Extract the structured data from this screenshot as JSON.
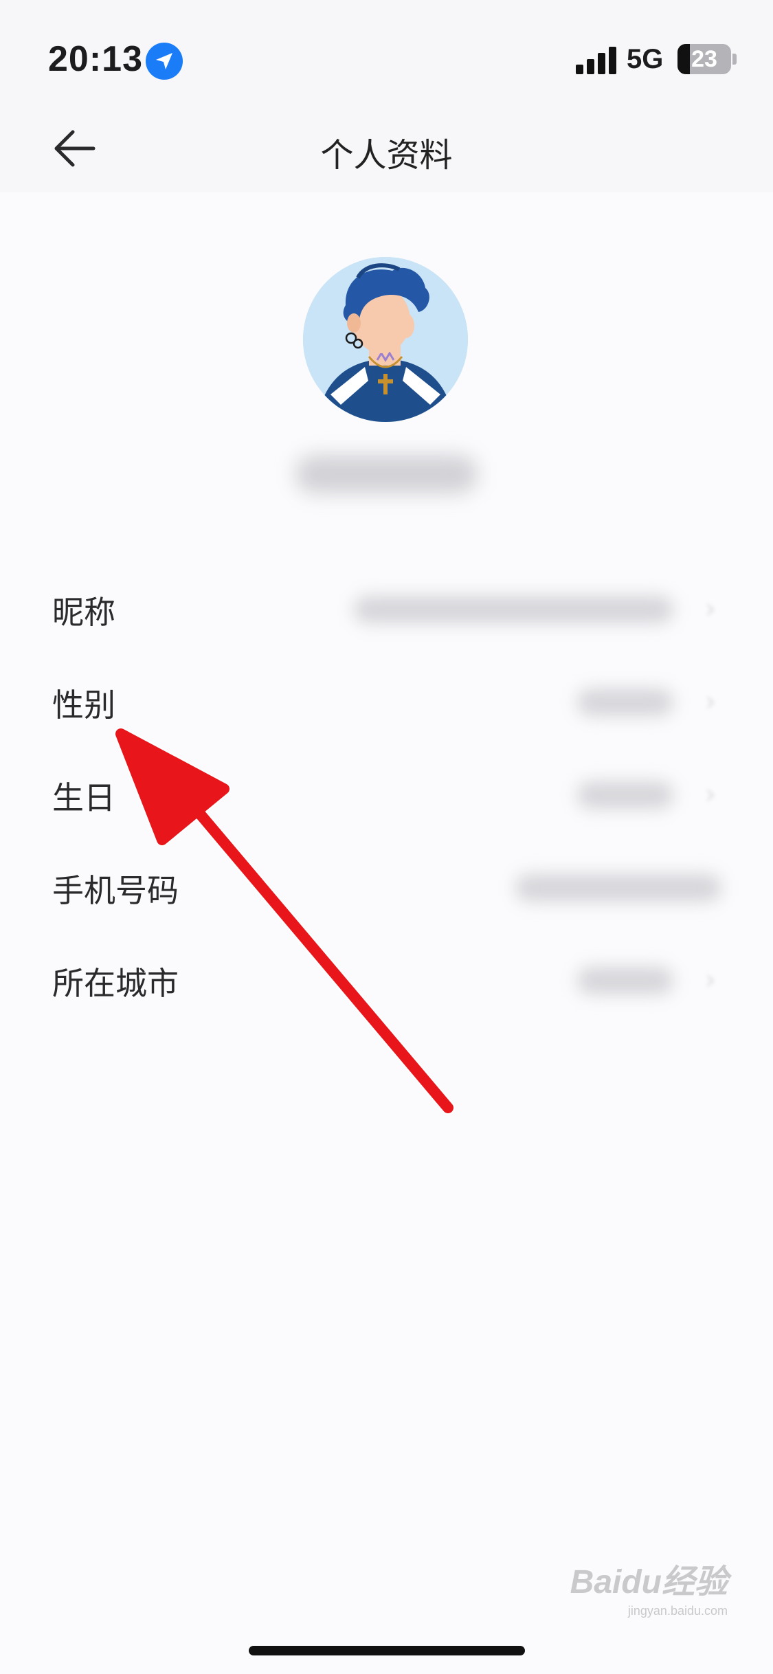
{
  "status_bar": {
    "time": "20:13",
    "network": "5G",
    "battery_level": "23",
    "battery_fraction": 0.23,
    "location_icon": "location-arrow-icon",
    "signal_icon": "cellular-signal-icon"
  },
  "nav": {
    "title": "个人资料",
    "back_icon": "arrow-left-icon"
  },
  "profile": {
    "avatar": "cartoon-avatar",
    "username": ""
  },
  "rows": [
    {
      "label": "昵称",
      "value": ""
    },
    {
      "label": "性别",
      "value": ""
    },
    {
      "label": "生日",
      "value": ""
    },
    {
      "label": "手机号码",
      "value": ""
    },
    {
      "label": "所在城市",
      "value": ""
    }
  ],
  "watermark": {
    "logo": "Baidu经验",
    "url": "jingyan.baidu.com"
  },
  "colors": {
    "accent_blue": "#1a7df7",
    "annotation_red": "#e8151b",
    "background": "#fbfbfd"
  }
}
